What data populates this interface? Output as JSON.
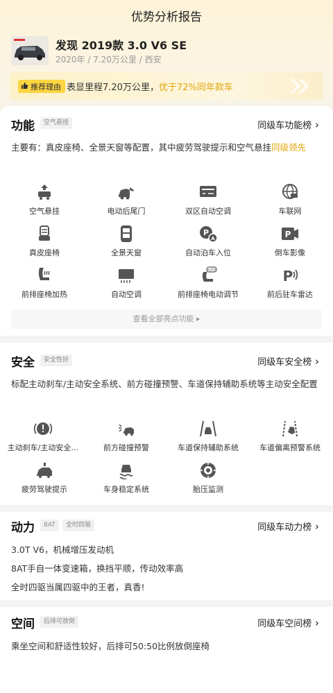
{
  "header": {
    "title": "优势分析报告"
  },
  "car": {
    "name": "发现 2019款 3.0 V6 SE",
    "meta": "2020年 / 7.20万公里 / 西安"
  },
  "recommend": {
    "tag": "推荐理由",
    "text": "表显里程7.20万公里，",
    "highlight": "优于72%同年款车"
  },
  "function": {
    "title": "功能",
    "tag": "空气悬挂",
    "rank": "同级车功能榜",
    "desc_prefix": "主要有：真皮座椅、全景天窗等配置，其中疲劳驾驶提示和空气悬挂",
    "desc_highlight": "同级领先",
    "features": [
      {
        "label": "空气悬挂",
        "icon": "air-suspension-icon"
      },
      {
        "label": "电动后尾门",
        "icon": "power-tailgate-icon"
      },
      {
        "label": "双区自动空调",
        "icon": "dual-zone-ac-icon"
      },
      {
        "label": "车联网",
        "icon": "connected-car-icon"
      },
      {
        "label": "真皮座椅",
        "icon": "leather-seat-icon"
      },
      {
        "label": "全景天窗",
        "icon": "panoramic-sunroof-icon"
      },
      {
        "label": "自动泊车入位",
        "icon": "auto-parking-icon"
      },
      {
        "label": "倒车影像",
        "icon": "reverse-camera-icon"
      },
      {
        "label": "前排座椅加热",
        "icon": "seat-heating-icon"
      },
      {
        "label": "自动空调",
        "icon": "auto-ac-icon"
      },
      {
        "label": "前排座椅电动调节",
        "icon": "power-seat-icon"
      },
      {
        "label": "前后驻车雷达",
        "icon": "parking-radar-icon"
      }
    ],
    "view_all": "查看全部亮点功能 ▸"
  },
  "safety": {
    "title": "安全",
    "tag": "安全性好",
    "rank": "同级车安全榜",
    "desc": "标配主动刹车/主动安全系统、前方碰撞预警、车道保持辅助系统等主动安全配置",
    "features": [
      {
        "label": "主动刹车/主动安全…",
        "icon": "active-brake-icon"
      },
      {
        "label": "前方碰撞预警",
        "icon": "collision-warning-icon"
      },
      {
        "label": "车道保持辅助系统",
        "icon": "lane-keep-icon"
      },
      {
        "label": "车道偏离预警系统",
        "icon": "lane-departure-icon"
      },
      {
        "label": "疲劳驾驶提示",
        "icon": "fatigue-alert-icon"
      },
      {
        "label": "车身稳定系统",
        "icon": "stability-control-icon"
      },
      {
        "label": "胎压监测",
        "icon": "tire-pressure-icon"
      }
    ]
  },
  "power": {
    "title": "动力",
    "tags": [
      "8AT",
      "全时四驱"
    ],
    "rank": "同级车动力榜",
    "lines": [
      "3.0T V6，机械增压发动机",
      "8AT手自一体变速箱，换挡平顺，传动效率高",
      "全时四驱当属四驱中的王者，真香!"
    ]
  },
  "space": {
    "title": "空间",
    "tag": "后排可放倒",
    "rank": "同级车空间榜",
    "desc": "乘坐空间和舒适性较好，后排可50:50比例放倒座椅"
  }
}
